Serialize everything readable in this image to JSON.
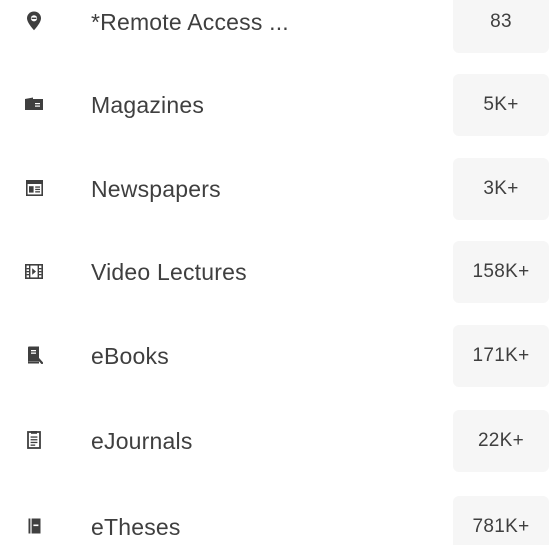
{
  "resources": [
    {
      "label": "*Remote Access ...",
      "count": "83",
      "icon": "location-pin-icon"
    },
    {
      "label": "Magazines",
      "count": "5K+",
      "icon": "magazine-icon"
    },
    {
      "label": "Newspapers",
      "count": "3K+",
      "icon": "newspaper-icon"
    },
    {
      "label": "Video Lectures",
      "count": "158K+",
      "icon": "film-strip-icon"
    },
    {
      "label": "eBooks",
      "count": "171K+",
      "icon": "book-icon"
    },
    {
      "label": "eJournals",
      "count": "22K+",
      "icon": "document-icon"
    },
    {
      "label": "eTheses",
      "count": "781K+",
      "icon": "thesis-book-icon"
    }
  ],
  "colors": {
    "icon": "#3f3f3f",
    "text": "#3f3f3f",
    "count_background": "#f6f6f6"
  }
}
